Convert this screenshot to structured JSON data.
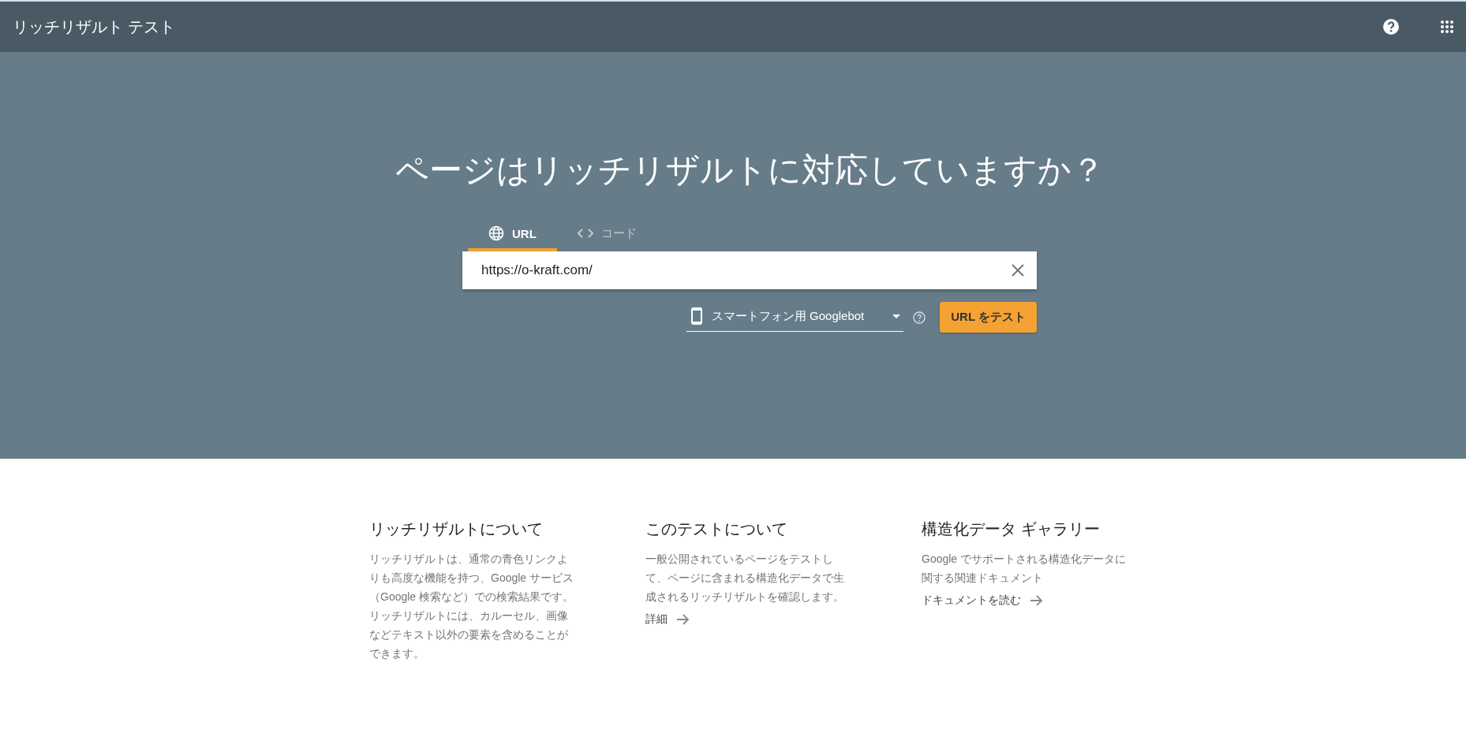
{
  "app_bar": {
    "title": "リッチリザルト テスト"
  },
  "hero": {
    "heading": "ページはリッチリザルトに対応していますか？",
    "tabs": [
      {
        "label": "URL",
        "kind": "globe",
        "selected": true
      },
      {
        "label": "コード",
        "kind": "code",
        "selected": false
      }
    ],
    "url_field": {
      "value": "https://o-kraft.com/"
    },
    "device_select": {
      "value": "スマートフォン用 Googlebot"
    },
    "test_button": "URL をテスト"
  },
  "info_columns": [
    {
      "heading": "リッチリザルトについて",
      "body": "リッチリザルトは、通常の青色リンクよりも高度な機能を持つ、Google サービス（Google 検索など）での検索結果です。リッチリザルトには、カルーセル、画像などテキスト以外の要素を含めることができます。"
    },
    {
      "heading": "このテストについて",
      "body": "一般公開されているページをテストして、ページに含まれる構造化データで生成されるリッチリザルトを確認します。",
      "link": "詳細"
    },
    {
      "heading": "構造化データ ギャラリー",
      "body": "Google でサポートされる構造化データに関する関連ドキュメント",
      "link": "ドキュメントを読む"
    }
  ]
}
